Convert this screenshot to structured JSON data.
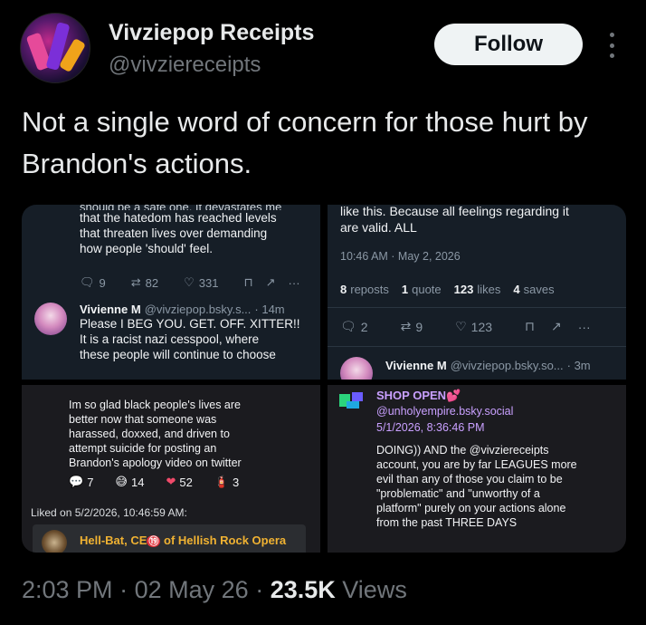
{
  "author": {
    "name": "Vivziepop Receipts",
    "handle": "@vivziereceipts",
    "follow_label": "Follow"
  },
  "tweet": {
    "text": "Not a single word of concern for those hurt by Brandon's actions.",
    "time": "2:03 PM",
    "date": "02 May 26",
    "views_count": "23.5K",
    "views_label": "Views",
    "sep": "·"
  },
  "panes": {
    "top_left": {
      "lines": [
        "that the hatedom has reached levels",
        "that threaten lives over demanding",
        "how people 'should' feel."
      ],
      "stats": {
        "replies": "9",
        "reposts": "82",
        "likes": "331"
      },
      "reply_name": "Vivienne M",
      "reply_handle": "@vivziepop.bsky.s...",
      "reply_age": "· 14m",
      "reply_lines": [
        "Please I BEG YOU. GET. OFF. XITTER!!",
        "It is a racist nazi cesspool, where",
        "these people will continue to choose"
      ]
    },
    "top_right": {
      "lines": [
        "like this. Because all feelings regarding it",
        "are valid. ALL"
      ],
      "timestamp": "10:46 AM · May 2, 2026",
      "reposts_count": "8",
      "reposts_label": "reposts",
      "quotes_count": "1",
      "quotes_label": "quote",
      "likes_count": "123",
      "likes_label": "likes",
      "saves_count": "4",
      "saves_label": "saves",
      "stats": {
        "replies": "2",
        "reposts": "9",
        "likes": "123"
      },
      "reply_name": "Vivienne M",
      "reply_handle": "@vivziepop.bsky.so...",
      "reply_age": "· 3m"
    },
    "bottom_left": {
      "lines": [
        "Im so glad black people's lives are",
        "better now that someone was",
        "harassed, doxxed, and driven to",
        "attempt suicide for posting an",
        "Brandon's apology video on twitter"
      ],
      "reactions": [
        {
          "emoji": "💬",
          "count": "7"
        },
        {
          "emoji": "😅",
          "count": "14"
        },
        {
          "emoji": "❤",
          "count": "52"
        },
        {
          "emoji": "🧯",
          "count": "3"
        }
      ],
      "liked_on": "Liked on 5/2/2026, 10:46:59 AM:",
      "quoted_name": "Hell-Bat, CE",
      "quoted_badge": "⑲",
      "quoted_rest": " of Hellish Rock Opera"
    },
    "bottom_right": {
      "name": "SHOP OPEN💕",
      "link": "@unholyempire.bsky.social",
      "date": "5/1/2026, 8:36:46 PM",
      "lines": [
        "DOING)) AND the @vivziereceipts",
        "account, you are by far LEAGUES more",
        "evil than any of those you claim to be",
        "\"problematic\" and \"unworthy of a",
        "platform\" purely on your actions alone",
        "from the past THREE DAYS"
      ]
    }
  }
}
